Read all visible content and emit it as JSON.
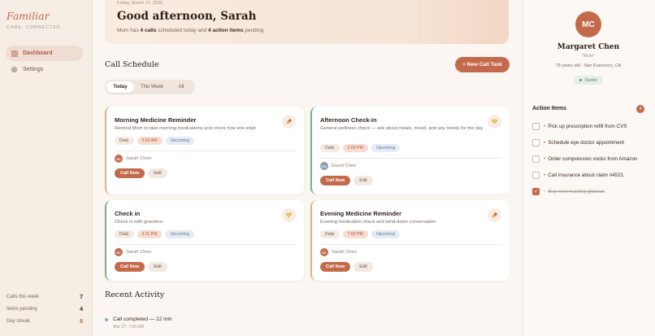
{
  "brand": {
    "name": "Familiar",
    "tagline": "CARE, CONNECTED"
  },
  "nav": [
    {
      "label": "Dashboard",
      "icon": "grid-icon",
      "active": true
    },
    {
      "label": "Settings",
      "icon": "gear-icon",
      "active": false
    }
  ],
  "stats": [
    {
      "label": "Calls this week",
      "value": "7"
    },
    {
      "label": "Items pending",
      "value": "4"
    },
    {
      "label": "Day streak",
      "value": "8"
    }
  ],
  "hero": {
    "date": "Friday, March 27, 2026",
    "greeting": "Good afternoon, Sarah",
    "sub_prefix": "Mom has ",
    "calls": "4 calls",
    "sub_mid": " scheduled today and ",
    "actions": "4 action items",
    "sub_suffix": " pending"
  },
  "schedule": {
    "title": "Call Schedule",
    "new_task": "+ New Call Task",
    "tabs": [
      "Today",
      "This Week",
      "All"
    ],
    "cards": [
      {
        "title": "Morning Medicine Reminder",
        "desc": "Remind Mom to take morning medications and check how she slept",
        "freq": "Daily",
        "time": "9:00 AM",
        "status": "Upcoming",
        "owner": "Sarah Chen",
        "initials": "SC",
        "icon": "pill-icon",
        "call": "Call Now",
        "edit": "Edit"
      },
      {
        "title": "Afternoon Check-in",
        "desc": "General wellness check — ask about meals, mood, and any needs for the day",
        "freq": "Daily",
        "time": "2:00 PM",
        "status": "Upcoming",
        "owner": "David Chen",
        "initials": "DC",
        "icon": "heart-icon",
        "call": "Call Now",
        "edit": "Edit"
      },
      {
        "title": "Check in",
        "desc": "Check in with grandma",
        "freq": "Daily",
        "time": "3:11 PM",
        "status": "Upcoming",
        "owner": "Sarah Chen",
        "initials": "SC",
        "icon": "heart-icon",
        "call": "Call Now",
        "edit": "Edit"
      },
      {
        "title": "Evening Medicine Reminder",
        "desc": "Evening medication check and wind-down conversation",
        "freq": "Daily",
        "time": "7:00 PM",
        "status": "Upcoming",
        "owner": "Sarah Chen",
        "initials": "SC",
        "icon": "pill-icon",
        "call": "Call Now",
        "edit": "Edit"
      }
    ]
  },
  "activity": {
    "title": "Recent Activity",
    "items": [
      {
        "text": "Call completed — 12 min",
        "time": "Mar 27, 7:00 AM"
      }
    ]
  },
  "profile": {
    "initials": "MC",
    "name": "Margaret Chen",
    "nickname": "\"Mom\"",
    "meta": "78 years old · San Francisco, CA",
    "status": "Stable"
  },
  "action_items": {
    "title": "Action Items",
    "count": "4",
    "items": [
      {
        "text": "Pick up prescription refill from CVS",
        "done": false
      },
      {
        "text": "Schedule eye doctor appointment",
        "done": false
      },
      {
        "text": "Order compression socks from Amazon",
        "done": false
      },
      {
        "text": "Call insurance about claim #4521",
        "done": false
      },
      {
        "text": "Buy new reading glasses",
        "done": true
      }
    ]
  },
  "colors": {
    "accent": "#c46a4c",
    "stable": "#5f8c6b",
    "background": "#fbf6f1"
  }
}
